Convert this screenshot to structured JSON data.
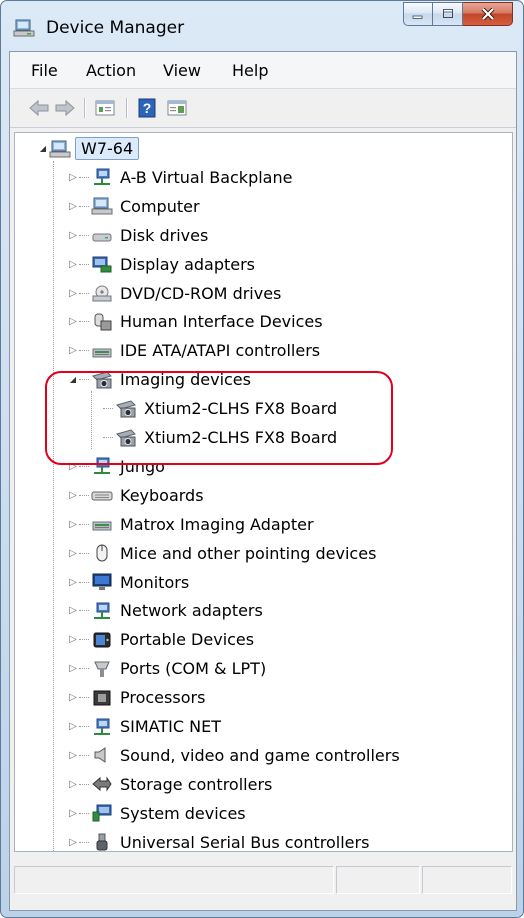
{
  "window": {
    "title": "Device Manager",
    "icons": {
      "title": "device-manager-icon",
      "minimize": "minimize-icon",
      "maximize": "maximize-icon",
      "close": "close-icon"
    }
  },
  "menu": [
    "File",
    "Action",
    "View",
    "Help"
  ],
  "toolbar": {
    "buttons": [
      "back-arrow-icon",
      "forward-arrow-icon",
      "properties-icon",
      "help-icon",
      "console-tree-icon"
    ]
  },
  "tree": {
    "root": {
      "label": "W7-64",
      "icon": "computer-icon",
      "expanded": true
    },
    "categories": [
      {
        "label": "A-B Virtual Backplane",
        "icon": "network-adapter-icon"
      },
      {
        "label": "Computer",
        "icon": "computer-icon"
      },
      {
        "label": "Disk drives",
        "icon": "disk-drive-icon"
      },
      {
        "label": "Display adapters",
        "icon": "display-adapter-icon"
      },
      {
        "label": "DVD/CD-ROM drives",
        "icon": "dvd-drive-icon"
      },
      {
        "label": "Human Interface Devices",
        "icon": "hid-icon"
      },
      {
        "label": "IDE ATA/ATAPI controllers",
        "icon": "ide-controller-icon"
      },
      {
        "label": "Imaging devices",
        "icon": "camera-icon",
        "expanded": true,
        "children": [
          {
            "label": "Xtium2-CLHS FX8 Board",
            "icon": "camera-icon"
          },
          {
            "label": "Xtium2-CLHS FX8 Board",
            "icon": "camera-icon"
          }
        ]
      },
      {
        "label": "Jungo",
        "icon": "network-adapter-icon"
      },
      {
        "label": "Keyboards",
        "icon": "keyboard-icon"
      },
      {
        "label": "Matrox Imaging Adapter",
        "icon": "ide-controller-icon"
      },
      {
        "label": "Mice and other pointing devices",
        "icon": "mouse-icon"
      },
      {
        "label": "Monitors",
        "icon": "monitor-icon"
      },
      {
        "label": "Network adapters",
        "icon": "network-adapter-icon"
      },
      {
        "label": "Portable Devices",
        "icon": "portable-device-icon"
      },
      {
        "label": "Ports (COM & LPT)",
        "icon": "port-icon"
      },
      {
        "label": "Processors",
        "icon": "processor-icon"
      },
      {
        "label": "SIMATIC NET",
        "icon": "network-adapter-icon"
      },
      {
        "label": "Sound, video and game controllers",
        "icon": "speaker-icon"
      },
      {
        "label": "Storage controllers",
        "icon": "storage-controller-icon"
      },
      {
        "label": "System devices",
        "icon": "system-devices-icon"
      },
      {
        "label": "Universal Serial Bus controllers",
        "icon": "usb-icon"
      }
    ]
  },
  "annotation": {
    "color": "#e2001a"
  },
  "colors": {
    "selection": "#dcebfc",
    "selection_border": "#7da2ce",
    "frame": "#c9dcef"
  }
}
